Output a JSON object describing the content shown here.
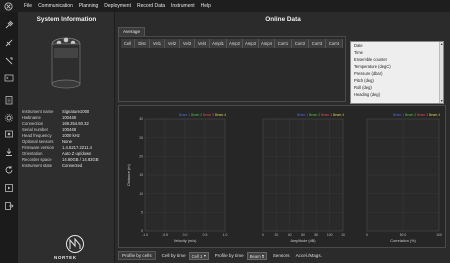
{
  "menu": [
    "File",
    "Communication",
    "Planning",
    "Deployment",
    "Record Data",
    "Instrument",
    "Help"
  ],
  "system_info": {
    "title": "System Information",
    "rows": [
      {
        "label": "Instrument name",
        "value": "Signature1000"
      },
      {
        "label": "Hwbname",
        "value": "100448"
      },
      {
        "label": "Connection",
        "value": "169.254.60.32"
      },
      {
        "label": "Serial number",
        "value": "100448"
      },
      {
        "label": "Head frequency",
        "value": "1000 kHz"
      },
      {
        "label": "Optional sensors",
        "value": "None"
      },
      {
        "label": "Firmware version",
        "value": "1.4.5217.2211.4"
      },
      {
        "label": "Orientation",
        "value": "Auto Z up/down"
      },
      {
        "label": "Recorder space",
        "value": "14.60GB / 14.83GB"
      },
      {
        "label": "Instrument state",
        "value": "Connected"
      }
    ],
    "logo_text": "NORTEK"
  },
  "online": {
    "title": "Online Data",
    "tab": "Average",
    "columns": [
      "Cell",
      "Dist",
      "Vel1",
      "Vel2",
      "Vel3",
      "Vel4",
      "Ampl1",
      "Amp2",
      "Amp3",
      "Amp4",
      "Corr1",
      "Corr2",
      "Corr3",
      "Corr4"
    ],
    "params": [
      "Date",
      "Time",
      "Ensemble counter",
      "Temperature (degC)",
      "Pressure (dbar)",
      "Pitch (deg)",
      "Roll (deg)",
      "Heading (deg)"
    ]
  },
  "plots": {
    "legend": [
      "Beam 1",
      "Beam 2",
      "Beam 3",
      "Beam 4"
    ],
    "legend_colors": [
      "#4f6bd8",
      "#4bbf4b",
      "#d84b4b",
      "#d8d24b"
    ],
    "ylabel": "Distance (m)",
    "y_ticks": [
      "30",
      "25",
      "20",
      "15",
      "10",
      "5",
      "0"
    ],
    "panels": [
      {
        "xlabel": "Velocity (m/s)",
        "x_ticks": [
          "-1.0",
          "-0.5",
          "0.0",
          "0.5",
          "1.0"
        ]
      },
      {
        "xlabel": "Amplitude (dB)",
        "x_ticks": [
          "0",
          "20",
          "40",
          "60",
          "80",
          "100",
          "10"
        ]
      },
      {
        "xlabel": "Correlation (%)",
        "x_ticks": [
          "0",
          "50.0",
          "100"
        ]
      }
    ]
  },
  "bottom": {
    "profile_cells": "Profile by cells",
    "cell_by_time": "Cell by time",
    "cell_select": "Cell 1",
    "profile_by_time": "Profile by time",
    "beam_select": "Beam 1",
    "sensors": "Sensors",
    "accel": "Accel./Mags."
  }
}
